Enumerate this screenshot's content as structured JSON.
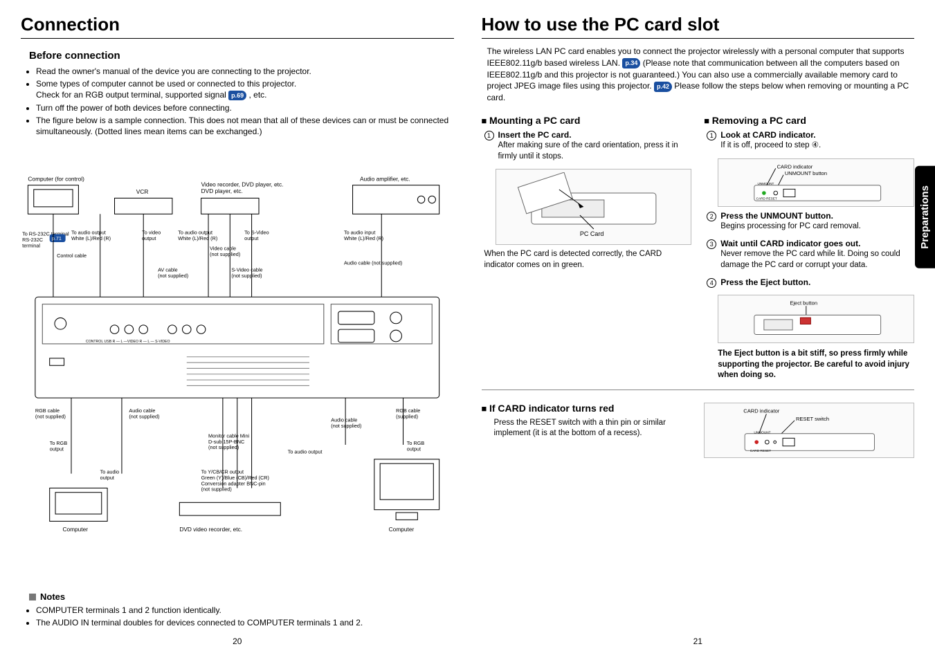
{
  "left": {
    "title": "Connection",
    "before_heading": "Before connection",
    "bullets": [
      "Read the owner's manual of the device you are connecting to the projector.",
      "Some types of computer cannot be used or connected to this projector.",
      "Turn off the power of both devices before connecting.",
      "The figure below is a sample connection. This does not mean that all of these devices can or must be connected simultaneously. (Dotted lines mean items can be exchanged.)"
    ],
    "check_line_a": "Check for an RGB output terminal, supported signal ",
    "check_ref": "p.69",
    "check_line_b": " , etc.",
    "diagram_labels": {
      "computer_control": "Computer (for control)",
      "vcr": "VCR",
      "video_recorder": "Video recorder,\nDVD player, etc.",
      "audio_amp": "Audio amplifier, etc.",
      "to_rs232c": "To\nRS-232C\nterminal",
      "p71": "p.71",
      "to_audio_out_lr1": "To audio output\nWhite (L)/Red (R)",
      "to_video_out": "To video\noutput",
      "to_audio_out_lr2": "To audio output\nWhite (L)/Red (R)",
      "to_svideo_out": "To S-Video\noutput",
      "to_audio_in_lr": "To audio input\nWhite (L)/Red (R)",
      "control_cable": "Control cable",
      "av_cable": "AV cable\n(not supplied)",
      "video_cable": "Video cable\n(not supplied)",
      "svideo_cable": "S-Video cable\n(not supplied)",
      "audio_cable_ns": "Audio cable (not supplied)",
      "rgb_cable_ns": "RGB cable\n(not supplied)",
      "audio_cable_ns2": "Audio cable\n(not supplied)",
      "monitor_cable": "Monitor cable Mini\nD-sub 15P-BNC\n(not supplied)",
      "to_audio_out2": "To audio output",
      "audio_cable_ns3": "Audio cable\n(not supplied)",
      "rgb_cable_s": "RGB cable\n(supplied)",
      "to_rgb_out1": "To RGB\noutput",
      "to_audio_out3": "To audio\noutput",
      "to_ycbcr": "To Y/CB/CR output\nGreen (Y)/Blue (CB)/Red (CR)\nConversion adapter BNC-pin\n(not supplied)",
      "to_rgb_out2": "To RGB\noutput",
      "computer_l": "Computer",
      "dvd_rec": "DVD video recorder, etc.",
      "computer_r": "Computer"
    },
    "notes_heading": "Notes",
    "notes": [
      "COMPUTER terminals 1 and 2 function identically.",
      "The AUDIO IN terminal doubles for devices connected to COMPUTER terminals 1 and 2."
    ],
    "page_num": "20"
  },
  "right": {
    "title": "How to use the PC card slot",
    "intro_a": "The wireless LAN PC card enables you to connect the projector wirelessly with a personal computer that supports IEEE802.11g/b based wireless LAN. ",
    "ref1": "p.34",
    "intro_b": " (Please note that communication between all the computers based on IEEE802.11g/b and this projector is not guaranteed.)  You can also use a commercially available memory card to project JPEG image files using this projector. ",
    "ref2": "p.42",
    "intro_c": "  Please follow the steps below when removing or mounting a PC card.",
    "mount_heading": "Mounting a PC card",
    "mount_step1_title": "Insert the PC card.",
    "mount_step1_body": "After making sure of the card orientation, press it in firmly until it stops.",
    "pc_card_label": "PC Card",
    "mount_detected": "When the PC card is detected correctly, the CARD indicator comes on in green.",
    "remove_heading": "Removing a PC card",
    "r_step1_title": "Look at CARD indicator.",
    "r_step1_body": "If it is off, proceed to step ④.",
    "r_diag_card": "CARD indicator",
    "r_diag_unmount": "UNMOUNT button",
    "r_step2_title": "Press the UNMOUNT button.",
    "r_step2_body": "Begins processing for PC card removal.",
    "r_step3_title": "Wait until CARD indicator goes out.",
    "r_step3_body": "Never remove the PC card while lit. Doing so could damage the PC card or corrupt your data.",
    "r_step4_title": "Press the Eject button.",
    "r_eject_label": "Eject button",
    "r_warn": "The Eject button is a bit stiff, so press firmly while supporting the projector. Be careful to avoid injury when doing so.",
    "red_heading": "If CARD indicator turns red",
    "red_body": "Press the RESET switch with a thin pin or similar implement (it is at the bottom of a recess).",
    "red_diag_card": "CARD indicator",
    "red_diag_reset": "RESET switch",
    "page_num": "21",
    "side_tab": "Preparations"
  }
}
